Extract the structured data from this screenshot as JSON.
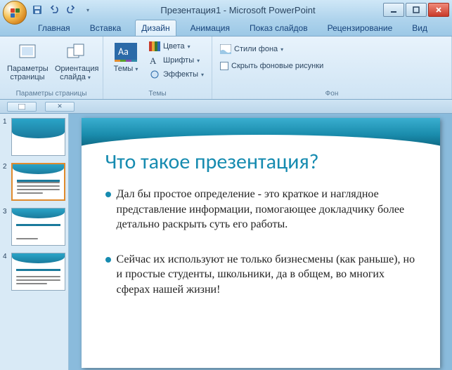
{
  "window": {
    "title": "Презентация1 - Microsoft PowerPoint"
  },
  "tabs": {
    "home": "Главная",
    "insert": "Вставка",
    "design": "Дизайн",
    "animations": "Анимация",
    "slideshow": "Показ слайдов",
    "review": "Рецензирование",
    "view": "Вид"
  },
  "ribbon": {
    "page_setup": {
      "params": "Параметры страницы",
      "orientation": "Ориентация слайда",
      "group_label": "Параметры страницы"
    },
    "themes": {
      "themes_btn": "Темы",
      "colors": "Цвета",
      "fonts": "Шрифты",
      "effects": "Эффекты",
      "group_label": "Темы"
    },
    "background": {
      "styles": "Стили фона",
      "hide_graphics": "Скрыть фоновые рисунки",
      "group_label": "Фон"
    }
  },
  "thumbs": [
    {
      "num": "1"
    },
    {
      "num": "2"
    },
    {
      "num": "3"
    },
    {
      "num": "4"
    }
  ],
  "slide": {
    "title": "Что такое презентация?",
    "bullet1": "Дал бы простое определение - это краткое и наглядное представление информации, помогающее докладчику более детально раскрыть суть его работы.",
    "bullet2": "Сейчас их используют не только бизнесмены (как раньше), но и простые студенты, школьники, да в общем, во многих сферах нашей жизни!"
  }
}
